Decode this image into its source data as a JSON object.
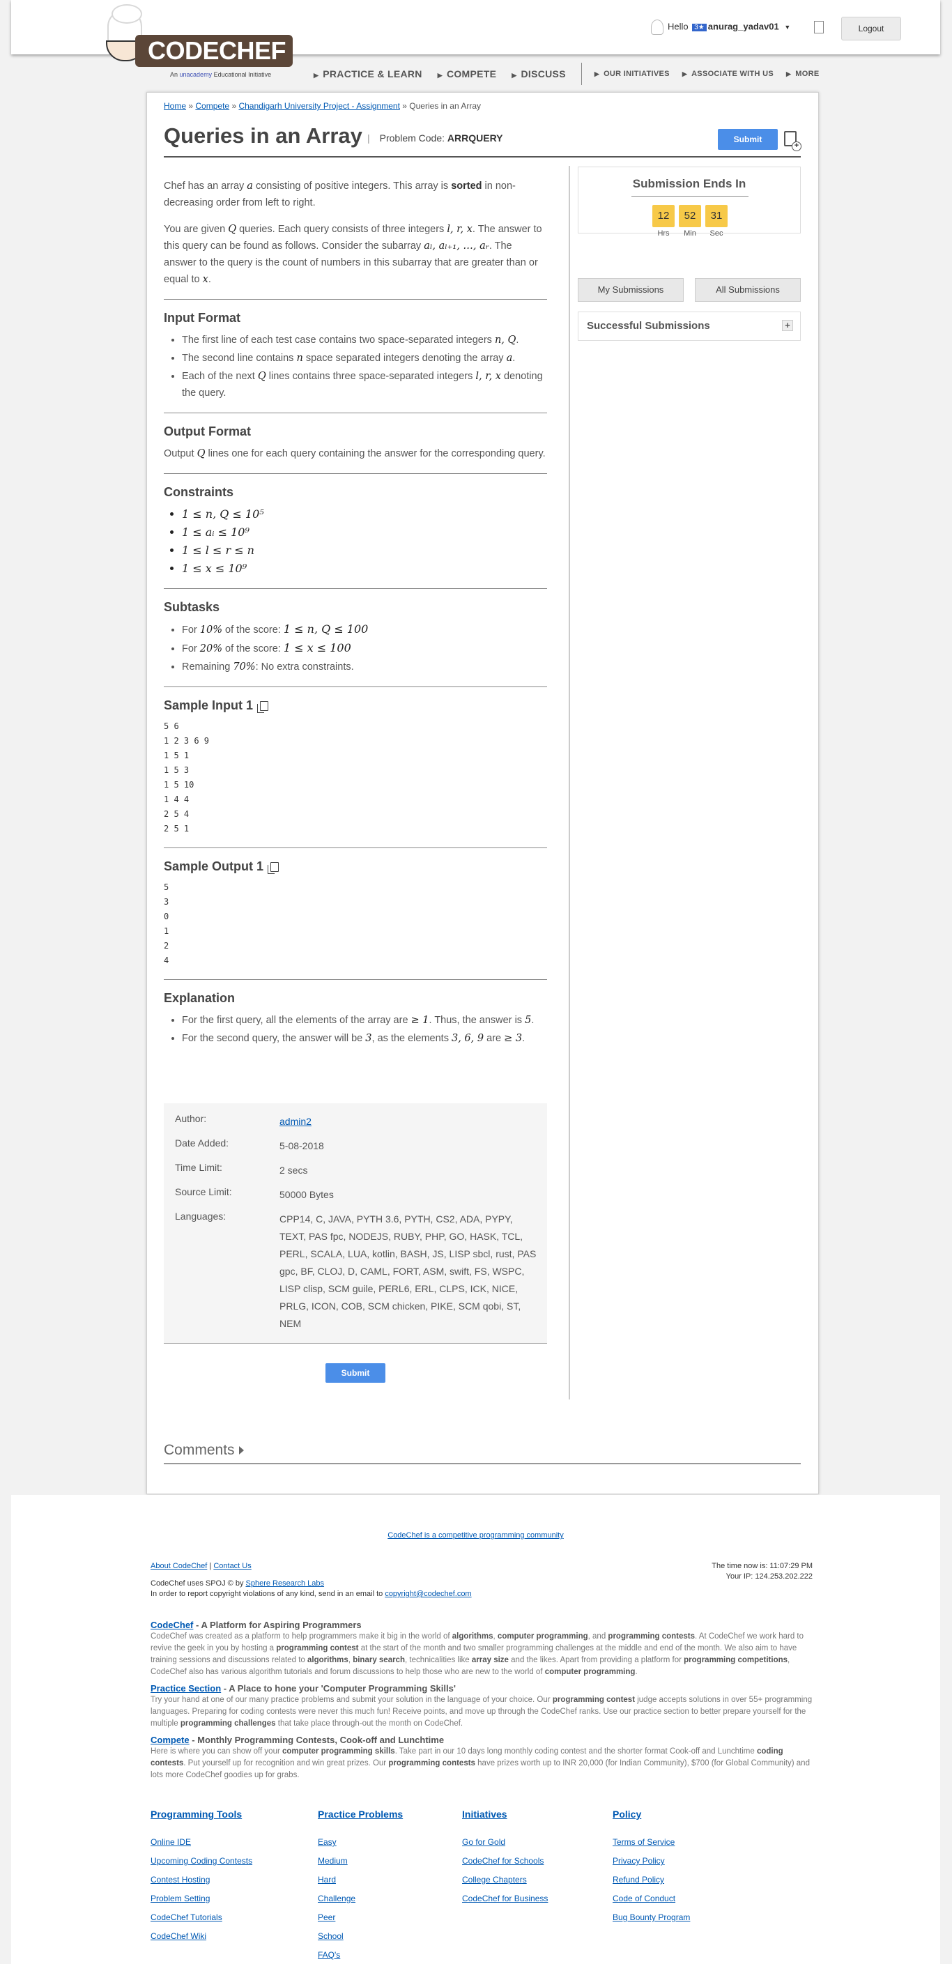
{
  "header": {
    "brand_wordmark": "CODECHEF",
    "brand_tagline_prefix": "An",
    "brand_tagline_mid": "unacademy",
    "brand_tagline_suffix": "Educational Initiative",
    "hello_text": "Hello",
    "user_badge": "3★",
    "username": "anurag_yadav01",
    "logout_label": "Logout",
    "nav": [
      "PRACTICE & LEARN",
      "COMPETE",
      "DISCUSS"
    ],
    "nav_secondary": [
      "OUR INITIATIVES",
      "ASSOCIATE WITH US",
      "MORE"
    ]
  },
  "breadcrumb": {
    "items": [
      "Home",
      "Compete",
      "Chandigarh University Project - Assignment"
    ],
    "current": "Queries in an Array",
    "sep": "»"
  },
  "problem": {
    "title": "Queries in an Array",
    "code_label": "Problem Code:",
    "code": "ARRQUERY",
    "submit_label": "Submit",
    "statement_1a": "Chef has an array",
    "statement_1b": "consisting of positive integers. This array is",
    "statement_1_bold": "sorted",
    "statement_1c": "in non-decreasing order from left to right.",
    "statement_2a": "You are given",
    "statement_2b": "queries. Each query consists of three integers",
    "statement_2c": ". The answer to this query can be found as follows. Consider the subarray",
    "statement_2d": ". The answer to the query is the count of numbers in this subarray that are greater than or equal to",
    "input_format_title": "Input Format",
    "input_items": [
      "The first line of each test case contains two space-separated integers",
      "The second line contains",
      "space separated integers denoting the array",
      "Each of the next",
      "lines contains three space-separated integers",
      "denoting the query."
    ],
    "output_format_title": "Output Format",
    "output_a": "Output",
    "output_b": "lines one for each query containing the answer for the corresponding query.",
    "constraints_title": "Constraints",
    "constraints": [
      "1 ≤ n, Q ≤ 10⁵",
      "1 ≤ aᵢ ≤ 10⁹",
      "1 ≤ l ≤ r ≤ n",
      "1 ≤ x ≤ 10⁹"
    ],
    "subtasks_title": "Subtasks",
    "subtask_1_pre": "For",
    "subtask_1_pct": "10%",
    "subtask_1_mid": "of the score:",
    "subtask_1_math": "1 ≤ n, Q ≤ 100",
    "subtask_2_pct": "20%",
    "subtask_2_math": "1 ≤ x ≤ 100",
    "subtask_3_pre": "Remaining",
    "subtask_3_pct": "70%",
    "subtask_3_post": ": No extra constraints.",
    "sample_input_title": "Sample Input 1",
    "sample_input": "5 6\n1 2 3 6 9\n1 5 1\n1 5 3\n1 5 10\n1 4 4\n2 5 4\n2 5 1",
    "sample_output_title": "Sample Output 1",
    "sample_output": "5\n3\n0\n1\n2\n4",
    "explanation_title": "Explanation",
    "explanation_1a": "For the first query, all the elements of the array are",
    "explanation_1b": ". Thus, the answer is",
    "explanation_2a": "For the second query, the answer will be",
    "explanation_2b": ", as the elements",
    "explanation_2c": "are"
  },
  "math": {
    "a": "a",
    "Q": "Q",
    "lrx": "l, r, x",
    "subarray": "aₗ, aₗ₊₁, …, aᵣ",
    "x": "x",
    "nQ": "n, Q",
    "n": "n",
    "ge1": "≥ 1",
    "five": "5",
    "three": "3",
    "elems": "3, 6, 9",
    "ge3": "≥ 3"
  },
  "meta": {
    "author_label": "Author:",
    "author": "admin2",
    "date_label": "Date Added:",
    "date": "5-08-2018",
    "time_label": "Time Limit:",
    "time": "2 secs",
    "source_label": "Source Limit:",
    "source": "50000 Bytes",
    "lang_label": "Languages:",
    "languages": "CPP14, C, JAVA, PYTH 3.6, PYTH, CS2, ADA, PYPY, TEXT, PAS fpc, NODEJS, RUBY, PHP, GO, HASK, TCL, PERL, SCALA, LUA, kotlin, BASH, JS, LISP sbcl, rust, PAS gpc, BF, CLOJ, D, CAML, FORT, ASM, swift, FS, WSPC, LISP clisp, SCM guile, PERL6, ERL, CLPS, ICK, NICE, PRLG, ICON, COB, SCM chicken, PIKE, SCM qobi, ST, NEM"
  },
  "sidebar": {
    "timer_title": "Submission Ends In",
    "hrs": "12",
    "min": "52",
    "sec": "31",
    "hrs_label": "Hrs",
    "min_label": "Min",
    "sec_label": "Sec",
    "my_submissions": "My Submissions",
    "all_submissions": "All Submissions",
    "successful": "Successful Submissions",
    "plus": "+"
  },
  "comments_label": "Comments",
  "footer": {
    "tagline": "CodeChef is a competitive programming community",
    "about_link": "About CodeChef",
    "divider": "|",
    "contact_link": "Contact Us",
    "spoj_pre": "CodeChef uses SPOJ © by",
    "spoj_link": "Sphere Research Labs",
    "copyright_pre": "In order to report copyright violations of any kind, send in an email to",
    "copyright_email": "copyright@codechef.com",
    "time_now": "The time now is: 11:07:29 PM",
    "ip": "Your IP: 124.253.202.222",
    "s1_link": "CodeChef",
    "s1_title": " - A Platform for Aspiring Programmers",
    "s1_p1": "CodeChef was created as a platform to help programmers make it big in the world of ",
    "s1_b1": "algorithms",
    "s1_p2": ", ",
    "s1_b2": "computer programming",
    "s1_p3": ", and ",
    "s1_b3": "programming contests",
    "s1_p4": ". At CodeChef we work hard to revive the geek in you by hosting a ",
    "s1_b4": "programming contest",
    "s1_p5": " at the start of the month and two smaller programming challenges at the middle and end of the month. We also aim to have training sessions and discussions related to ",
    "s1_b5": "algorithms",
    "s1_p6": ", ",
    "s1_b6": "binary search",
    "s1_p7": ", technicalities like ",
    "s1_b7": "array size",
    "s1_p8": " and the likes. Apart from providing a platform for ",
    "s1_b8": "programming competitions",
    "s1_p9": ", CodeChef also has various algorithm tutorials and forum discussions to help those who are new to the world of ",
    "s1_b9": "computer programming",
    "s1_p10": ".",
    "s2_link": "Practice Section",
    "s2_title": " - A Place to hone your 'Computer Programming Skills'",
    "s2_p1": "Try your hand at one of our many practice problems and submit your solution in the language of your choice. Our ",
    "s2_b1": "programming contest",
    "s2_p2": " judge accepts solutions in over 55+ programming languages. Preparing for coding contests were never this much fun! Receive points, and move up through the CodeChef ranks. Use our practice section to better prepare yourself for the multiple ",
    "s2_b2": "programming challenges",
    "s2_p3": " that take place through-out the month on CodeChef.",
    "s3_link": "Compete",
    "s3_title": " - Monthly Programming Contests, Cook-off and Lunchtime",
    "s3_p1": "Here is where you can show off your ",
    "s3_b1": "computer programming skills",
    "s3_p2": ". Take part in our 10 days long monthly coding contest and the shorter format Cook-off and Lunchtime ",
    "s3_b2": "coding contests",
    "s3_p3": ". Put yourself up for recognition and win great prizes. Our ",
    "s3_b3": "programming contests",
    "s3_p4": " have prizes worth up to INR 20,000 (for Indian Community), $700 (for Global Community) and lots more CodeChef goodies up for grabs.",
    "col1_title": "Programming Tools",
    "col1": [
      "Online IDE",
      "Upcoming Coding Contests",
      "Contest Hosting",
      "Problem Setting",
      "CodeChef Tutorials",
      "CodeChef Wiki"
    ],
    "col2_title": "Practice Problems",
    "col2": [
      "Easy",
      "Medium",
      "Hard",
      "Challenge",
      "Peer",
      "School",
      "FAQ's"
    ],
    "col3_title": "Initiatives",
    "col3": [
      "Go for Gold",
      "CodeChef for Schools",
      "College Chapters",
      "CodeChef for Business"
    ],
    "col4_title": "Policy",
    "col4": [
      "Terms of Service",
      "Privacy Policy",
      "Refund Policy",
      "Code of Conduct",
      "Bug Bounty Program"
    ]
  }
}
